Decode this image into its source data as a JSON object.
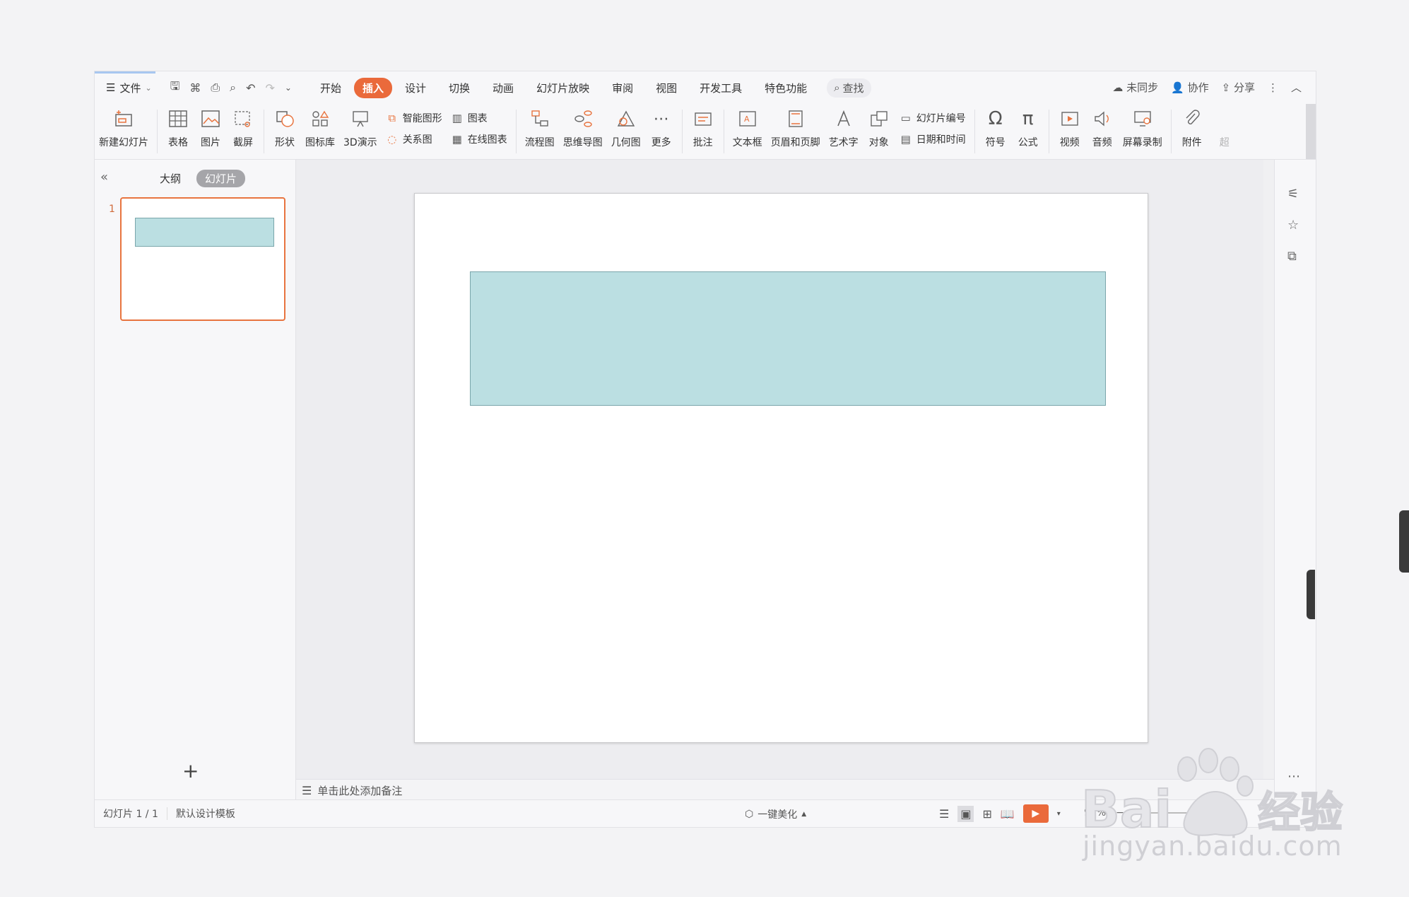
{
  "tabbar": {
    "file_label": "文件",
    "tabs": [
      "开始",
      "插入",
      "设计",
      "切换",
      "动画",
      "幻灯片放映",
      "审阅",
      "视图",
      "开发工具",
      "特色功能"
    ],
    "active_tab": "插入",
    "search_label": "查找",
    "sync_label": "未同步",
    "collab_label": "协作",
    "share_label": "分享"
  },
  "ribbon": {
    "new_slide": "新建幻灯片",
    "table": "表格",
    "picture": "图片",
    "screenshot": "截屏",
    "shape": "形状",
    "icon_lib": "图标库",
    "demo3d": "3D演示",
    "smart_art": "智能图形",
    "relation": "关系图",
    "chart": "图表",
    "online_chart": "在线图表",
    "flowchart": "流程图",
    "mindmap": "思维导图",
    "geometry": "几何图",
    "more": "更多",
    "comment": "批注",
    "textbox": "文本框",
    "header_footer": "页眉和页脚",
    "wordart": "艺术字",
    "object": "对象",
    "slide_number": "幻灯片编号",
    "date_time": "日期和时间",
    "symbol": "符号",
    "formula": "公式",
    "video": "视频",
    "audio": "音频",
    "screen_record": "屏幕录制",
    "attachment": "附件",
    "overflow": "超"
  },
  "leftpanel": {
    "outline_tab": "大纲",
    "slides_tab": "幻灯片",
    "slide_number": "1",
    "add_symbol": "+"
  },
  "notes": {
    "placeholder": "单击此处添加备注"
  },
  "status": {
    "slide_count": "幻灯片 1 / 1",
    "template": "默认设计模板",
    "beautify": "一键美化",
    "zoom": "90%"
  },
  "colors": {
    "accent": "#ea6a3b",
    "shape_fill": "#bbdfe2",
    "shape_border": "#7aa6ab"
  },
  "watermark": {
    "brand": "Baidu",
    "brand_cn": "经验",
    "url": "jingyan.baidu.com"
  }
}
